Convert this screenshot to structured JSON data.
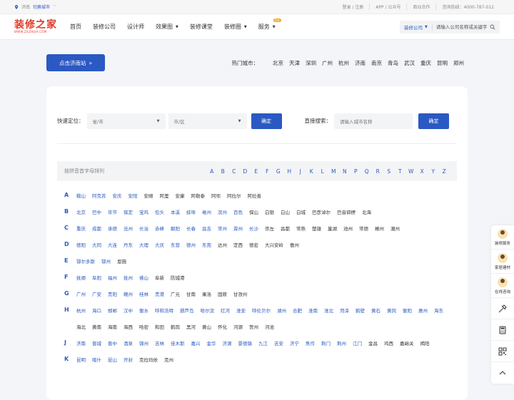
{
  "topbar": {
    "city": "济南",
    "switch_label": "切换城市",
    "links": [
      "登录 / 注册",
      "APP / 公众号",
      "商业合作",
      "咨询热线：4000-787-012"
    ]
  },
  "logo": {
    "text": "装修之家",
    "url": "WWW.ZXZHIJIA.COM"
  },
  "nav": {
    "items": [
      {
        "label": "首页",
        "dropdown": false
      },
      {
        "label": "装修公司",
        "dropdown": false
      },
      {
        "label": "设计师",
        "dropdown": false
      },
      {
        "label": "效果图",
        "dropdown": true
      },
      {
        "label": "装修课堂",
        "dropdown": false
      },
      {
        "label": "装修圈",
        "dropdown": true
      },
      {
        "label": "服务",
        "dropdown": true,
        "badge": "hot"
      }
    ],
    "search": {
      "select_label": "装修公司",
      "placeholder": "请输入公司名称或关键字"
    }
  },
  "city_bar": {
    "go_button": "点击济南站",
    "hot_label": "热门城市：",
    "hot_cities": [
      "北京",
      "天津",
      "深圳",
      "广州",
      "杭州",
      "济南",
      "南京",
      "青岛",
      "武汉",
      "重庆",
      "昆明",
      "郑州"
    ]
  },
  "quick": {
    "label": "快速定位：",
    "province_placeholder": "省/市",
    "city_placeholder": "市/区",
    "confirm1": "确定",
    "direct_label": "直接搜索：",
    "direct_placeholder": "请输入城市名称",
    "confirm2": "确定"
  },
  "letterbar": {
    "label": "按拼音首字母排列",
    "letters": [
      "A",
      "B",
      "C",
      "D",
      "E",
      "F",
      "G",
      "H",
      "J",
      "K",
      "L",
      "M",
      "N",
      "P",
      "Q",
      "R",
      "S",
      "T",
      "W",
      "X",
      "Y",
      "Z"
    ]
  },
  "groups": [
    {
      "letter": "A",
      "cities": [
        "鞍山",
        "阿克苏",
        "安庆",
        "安阳",
        "安顺",
        "阿里",
        "安康",
        "阿勒泰",
        "阿坝",
        "阿拉尔",
        "阿拉善"
      ],
      "dark_from": 4
    },
    {
      "letter": "B",
      "cities": [
        "北京",
        "巴中",
        "毕节",
        "保定",
        "宝鸡",
        "包头",
        "本溪",
        "蚌埠",
        "亳州",
        "滨州",
        "百色",
        "保山",
        "白银",
        "白山",
        "白城",
        "巴彦淖尔",
        "巴音郭楞",
        "北海"
      ],
      "dark_from": 11
    },
    {
      "letter": "C",
      "cities": [
        "重庆",
        "成都",
        "承德",
        "沧州",
        "长治",
        "赤峰",
        "朝阳",
        "长春",
        "昌吉",
        "常州",
        "滁州",
        "长沙",
        "崇左",
        "昌都",
        "常熟",
        "楚雄",
        "巢湖",
        "池州",
        "常德",
        "郴州",
        "潮州"
      ],
      "dark_from": 12
    },
    {
      "letter": "D",
      "cities": [
        "德阳",
        "大同",
        "大连",
        "丹东",
        "大理",
        "大庆",
        "东营",
        "德州",
        "东莞",
        "达州",
        "定西",
        "德宏",
        "大兴安岭",
        "儋州"
      ],
      "dark_from": 9
    },
    {
      "letter": "E",
      "cities": [
        "鄂尔多斯",
        "鄂州",
        "恩施"
      ],
      "dark_from": 2
    },
    {
      "letter": "F",
      "cities": [
        "抚顺",
        "阜阳",
        "福州",
        "抚州",
        "佛山",
        "阜新",
        "防城港"
      ],
      "dark_from": 5
    },
    {
      "letter": "G",
      "cities": [
        "广州",
        "广安",
        "贵阳",
        "赣州",
        "桂林",
        "贵港",
        "广元",
        "甘南",
        "果洛",
        "固原",
        "甘孜州"
      ],
      "dark_from": 6
    },
    {
      "letter": "H",
      "cities": [
        "杭州",
        "海口",
        "邯郸",
        "汉中",
        "衡水",
        "呼和浩特",
        "葫芦岛",
        "哈尔滨",
        "红河",
        "淮安",
        "呼伦贝尔",
        "湖州",
        "合肥",
        "淮南",
        "淮北",
        "菏泽",
        "鹤壁",
        "黄石",
        "黄冈",
        "衡阳",
        "惠州",
        "海东",
        "海北",
        "黄南",
        "海南",
        "海西",
        "哈密",
        "和田",
        "鹤岗",
        "黑河",
        "黄山",
        "怀化",
        "河源",
        "贺州",
        "河池"
      ],
      "dark_from": 22
    },
    {
      "letter": "J",
      "cities": [
        "济南",
        "晋城",
        "晋中",
        "酒泉",
        "锦州",
        "吉林",
        "佳木斯",
        "嘉兴",
        "金华",
        "济源",
        "景德镇",
        "九江",
        "吉安",
        "济宁",
        "焦作",
        "荆门",
        "荆州",
        "江门",
        "金昌",
        "鸡西",
        "嘉峪关",
        "揭阳"
      ],
      "dark_from": 18
    },
    {
      "letter": "K",
      "cities": [
        "昆明",
        "喀什",
        "昆山",
        "开封",
        "克拉玛依",
        "克州"
      ],
      "dark_from": 4
    }
  ],
  "side": {
    "items": [
      "装修服务",
      "家居建材",
      "在线咨询"
    ],
    "icons": [
      "tools-icon",
      "calculator-icon",
      "qrcode-icon",
      "back-to-top-icon"
    ]
  },
  "colors": {
    "accent": "#2b59c3",
    "brand": "#e03a2a",
    "hot_badge": "#f5a623"
  }
}
